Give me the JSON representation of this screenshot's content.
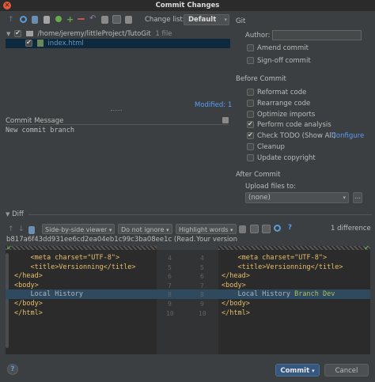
{
  "window": {
    "title": "Commit Changes"
  },
  "changelist": {
    "label": "Change list:",
    "value": "Default"
  },
  "tree": {
    "root": {
      "path": "/home/jeremy/littleProject/TutoGit",
      "count": "1 file"
    },
    "file": {
      "name": "index.html"
    }
  },
  "modified_label": "Modified: 1",
  "commit_message": {
    "label": "Commit Message",
    "value": "New commit branch"
  },
  "git": {
    "header": "Git",
    "author_label": "Author:",
    "author_value": "",
    "amend": "Amend commit",
    "signoff": "Sign-off commit"
  },
  "before_commit": {
    "header": "Before Commit",
    "options": [
      {
        "label": "Reformat code",
        "checked": false
      },
      {
        "label": "Rearrange code",
        "checked": false
      },
      {
        "label": "Optimize imports",
        "checked": false
      },
      {
        "label": "Perform code analysis",
        "checked": true
      },
      {
        "label": "Check TODO (Show All)",
        "checked": true
      },
      {
        "label": "Cleanup",
        "checked": false
      },
      {
        "label": "Update copyright",
        "checked": false
      }
    ],
    "configure_link": "Configure"
  },
  "after_commit": {
    "header": "After Commit",
    "upload_label": "Upload files to:",
    "upload_value": "(none)",
    "upload_more": "..."
  },
  "diff": {
    "header": "Diff",
    "viewer": "Side-by-side viewer",
    "ignore": "Do not ignore",
    "highlight": "Highlight words",
    "help": "?",
    "difference_count": "1 difference",
    "left_title": "b817a6f43dd931ee6cd2ea04eb1c99c3ba08ee1c (Read...",
    "right_title": "Your version",
    "left_lines": [
      {
        "indent": "    ",
        "text": "<meta charset=\"UTF-8\">",
        "num": "4"
      },
      {
        "indent": "    ",
        "text": "<title>Versionning</title>",
        "num": "5"
      },
      {
        "indent": "",
        "text": "</head>",
        "num": "6"
      },
      {
        "indent": "",
        "text": "<body>",
        "num": "7"
      },
      {
        "indent": "    ",
        "text": "Local History",
        "num": "8"
      },
      {
        "indent": "",
        "text": "</body>",
        "num": "9"
      },
      {
        "indent": "",
        "text": "</html>",
        "num": "10"
      }
    ],
    "right_lines": [
      {
        "indent": "    ",
        "text": "<meta charset=\"UTF-8\">",
        "num": "4"
      },
      {
        "indent": "    ",
        "text": "<title>Versionning</title>",
        "num": "5"
      },
      {
        "indent": "",
        "text": "</head>",
        "num": "6"
      },
      {
        "indent": "",
        "text": "<body>",
        "num": "7"
      },
      {
        "indent": "    ",
        "text": "Local History ",
        "added": "Branch Dev",
        "num": "8"
      },
      {
        "indent": "",
        "text": "</body>",
        "num": "9"
      },
      {
        "indent": "",
        "text": "</html>",
        "num": "10"
      }
    ]
  },
  "footer": {
    "help": "?",
    "commit": "Commit",
    "cancel": "Cancel"
  },
  "colors": {
    "accent": "#4a88c7",
    "link": "#589df6",
    "changed_line": "#2f4a5e"
  }
}
